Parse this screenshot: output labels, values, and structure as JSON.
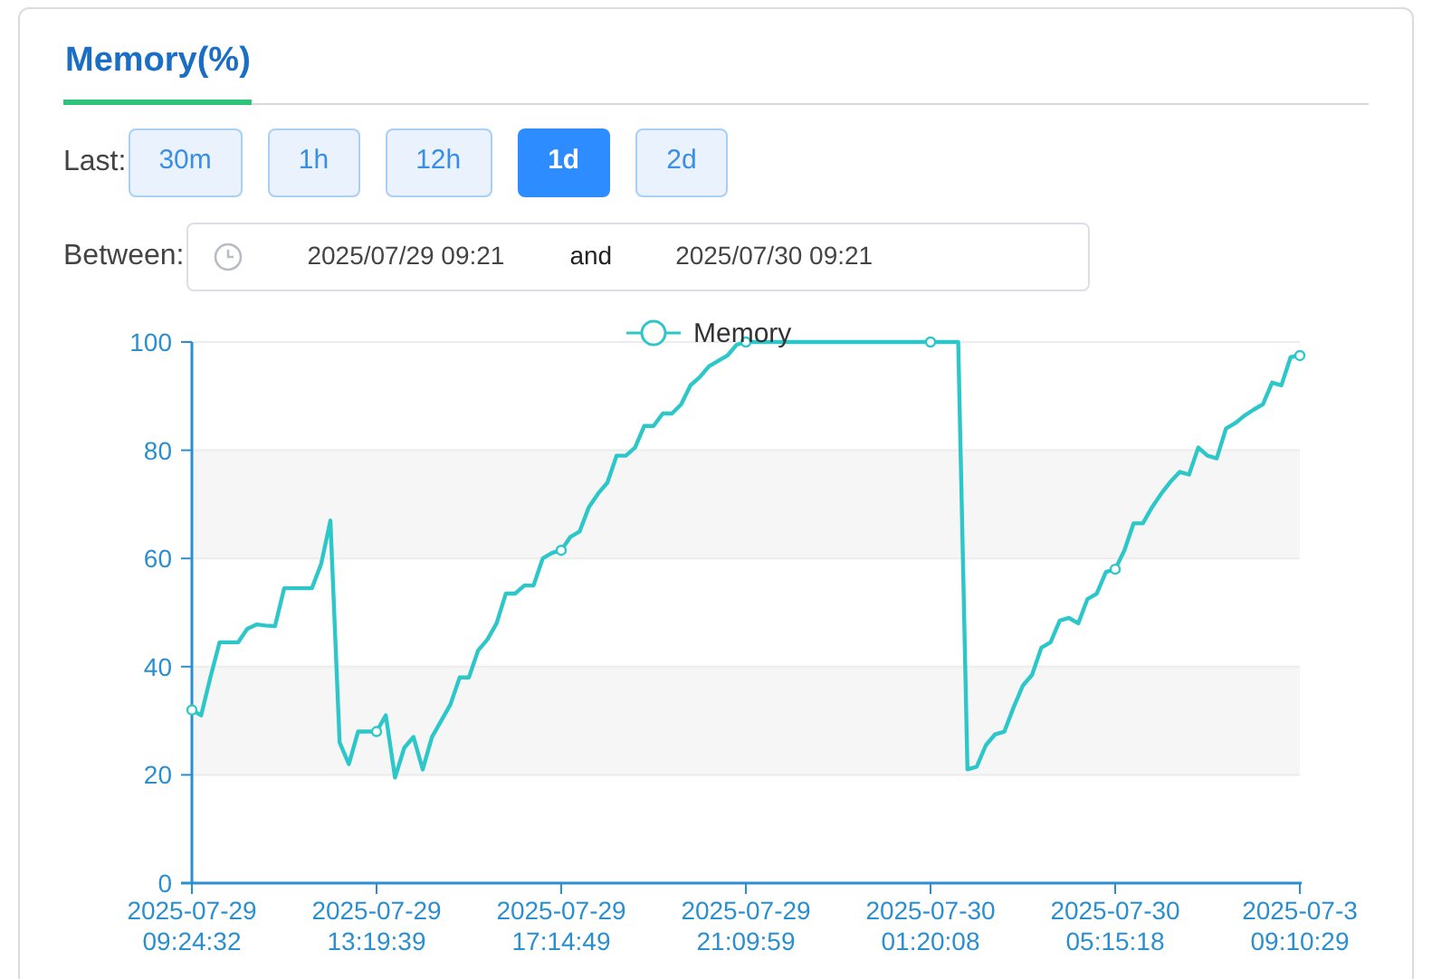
{
  "panel": {
    "title": "Memory(%)"
  },
  "last": {
    "label": "Last:",
    "options": [
      {
        "label": "30m",
        "selected": false
      },
      {
        "label": "1h",
        "selected": false
      },
      {
        "label": "12h",
        "selected": false
      },
      {
        "label": "1d",
        "selected": true
      },
      {
        "label": "2d",
        "selected": false
      }
    ]
  },
  "between": {
    "label": "Between:",
    "start": "2025/07/29 09:21",
    "joiner": "and",
    "end": "2025/07/30 09:21"
  },
  "chart_data": {
    "type": "line",
    "grid": true,
    "ylim": [
      0,
      100
    ],
    "yticks": [
      0,
      20,
      40,
      60,
      80,
      100
    ],
    "categories": [
      "2025-07-29\n09:24:32",
      null,
      null,
      null,
      null,
      null,
      null,
      null,
      null,
      null,
      null,
      null,
      null,
      null,
      null,
      null,
      null,
      null,
      null,
      null,
      "2025-07-29\n13:19:39",
      null,
      null,
      null,
      null,
      null,
      null,
      null,
      null,
      null,
      null,
      null,
      null,
      null,
      null,
      null,
      null,
      null,
      null,
      null,
      "2025-07-29\n17:14:49",
      null,
      null,
      null,
      null,
      null,
      null,
      null,
      null,
      null,
      null,
      null,
      null,
      null,
      null,
      null,
      null,
      null,
      null,
      null,
      "2025-07-29\n21:09:59",
      null,
      null,
      null,
      null,
      null,
      null,
      null,
      null,
      null,
      null,
      null,
      null,
      null,
      null,
      null,
      null,
      null,
      null,
      null,
      "2025-07-30\n01:20:08",
      null,
      null,
      null,
      null,
      null,
      null,
      null,
      null,
      null,
      null,
      null,
      null,
      null,
      null,
      null,
      null,
      null,
      null,
      null,
      "2025-07-30\n05:15:18",
      null,
      null,
      null,
      null,
      null,
      null,
      null,
      null,
      null,
      null,
      null,
      null,
      null,
      null,
      null,
      null,
      null,
      null,
      null,
      "2025-07-3\n09:10:29"
    ],
    "series": [
      {
        "name": "Memory",
        "color": "#2ec7c9",
        "values": [
          32,
          31,
          38,
          44.5,
          44.5,
          44.5,
          47,
          47.8,
          47.6,
          47.5,
          54.5,
          54.5,
          54.5,
          54.5,
          59,
          67,
          26,
          22,
          28,
          28,
          28,
          31,
          19.5,
          25,
          27,
          21,
          27,
          30,
          33,
          38,
          38,
          43,
          45,
          48,
          53.5,
          53.5,
          55,
          55,
          60,
          61,
          61.5,
          64,
          65,
          69.5,
          72,
          74,
          79,
          79,
          80.5,
          84.5,
          84.5,
          86.8,
          86.8,
          88.5,
          92,
          93.5,
          95.5,
          96.5,
          97.5,
          99.5,
          100,
          100,
          100,
          100,
          100,
          100,
          100,
          100,
          100,
          100,
          100,
          100,
          100,
          100,
          100,
          100,
          100,
          100,
          100,
          100,
          100,
          100,
          100,
          100,
          21,
          21.5,
          25.5,
          27.5,
          28,
          32.5,
          36.5,
          38.5,
          43.5,
          44.5,
          48.5,
          49,
          48,
          52.5,
          53.5,
          57.5,
          58,
          61.5,
          66.5,
          66.5,
          69.5,
          72,
          74.2,
          76,
          75.5,
          80.5,
          79,
          78.5,
          84,
          85,
          86.4,
          87.5,
          88.5,
          92.5,
          92,
          97.2,
          97.5
        ]
      }
    ]
  }
}
